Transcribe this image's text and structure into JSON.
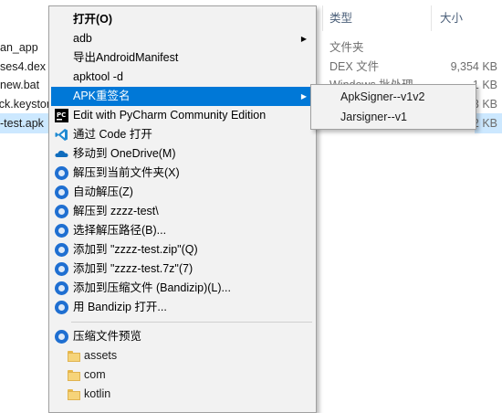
{
  "explorer": {
    "headers": {
      "type": "类型",
      "size": "大小"
    },
    "rows": [
      {
        "name": "an_app",
        "type": "文件夹",
        "size": ""
      },
      {
        "name": "ses4.dex",
        "type": "DEX 文件",
        "size": "9,354 KB"
      },
      {
        "name": "new.bat",
        "type": "Windows 批处理...",
        "size": "1 KB"
      },
      {
        "name": "ck.keystore",
        "type": "",
        "size": "3 KB"
      },
      {
        "name": "-test.apk",
        "type": "",
        "size": "2 KB"
      }
    ]
  },
  "menu": {
    "items": [
      {
        "label": "打开(O)",
        "bold": true
      },
      {
        "label": "adb",
        "submenu": true
      },
      {
        "label": "导出AndroidManifest"
      },
      {
        "label": "apktool -d"
      },
      {
        "label": "APK重签名",
        "submenu": true,
        "highlighted": true
      },
      {
        "label": "Edit with PyCharm Community Edition",
        "icon": "pycharm-icon"
      },
      {
        "label": "通过 Code 打开",
        "icon": "vscode-icon"
      },
      {
        "label": "移动到 OneDrive(M)",
        "icon": "onedrive-icon"
      },
      {
        "label": "解压到当前文件夹(X)",
        "icon": "bandizip-icon"
      },
      {
        "label": "自动解压(Z)",
        "icon": "bandizip-icon"
      },
      {
        "label": "解压到 zzzz-test\\",
        "icon": "bandizip-icon"
      },
      {
        "label": "选择解压路径(B)...",
        "icon": "bandizip-icon"
      },
      {
        "label": "添加到 \"zzzz-test.zip\"(Q)",
        "icon": "bandizip-icon"
      },
      {
        "label": "添加到 \"zzzz-test.7z\"(7)",
        "icon": "bandizip-icon"
      },
      {
        "label": "添加到压缩文件 (Bandizip)(L)...",
        "icon": "bandizip-icon"
      },
      {
        "label": "用 Bandizip 打开...",
        "icon": "bandizip-icon"
      }
    ],
    "preview_label": "压缩文件预览",
    "folders": [
      "assets",
      "com",
      "kotlin"
    ]
  },
  "submenu": {
    "items": [
      "ApkSigner--v1v2",
      "Jarsigner--v1"
    ]
  },
  "colors": {
    "highlight": "#0078d7",
    "menu_bg": "#f2f2f2",
    "selection": "#cce8ff"
  }
}
